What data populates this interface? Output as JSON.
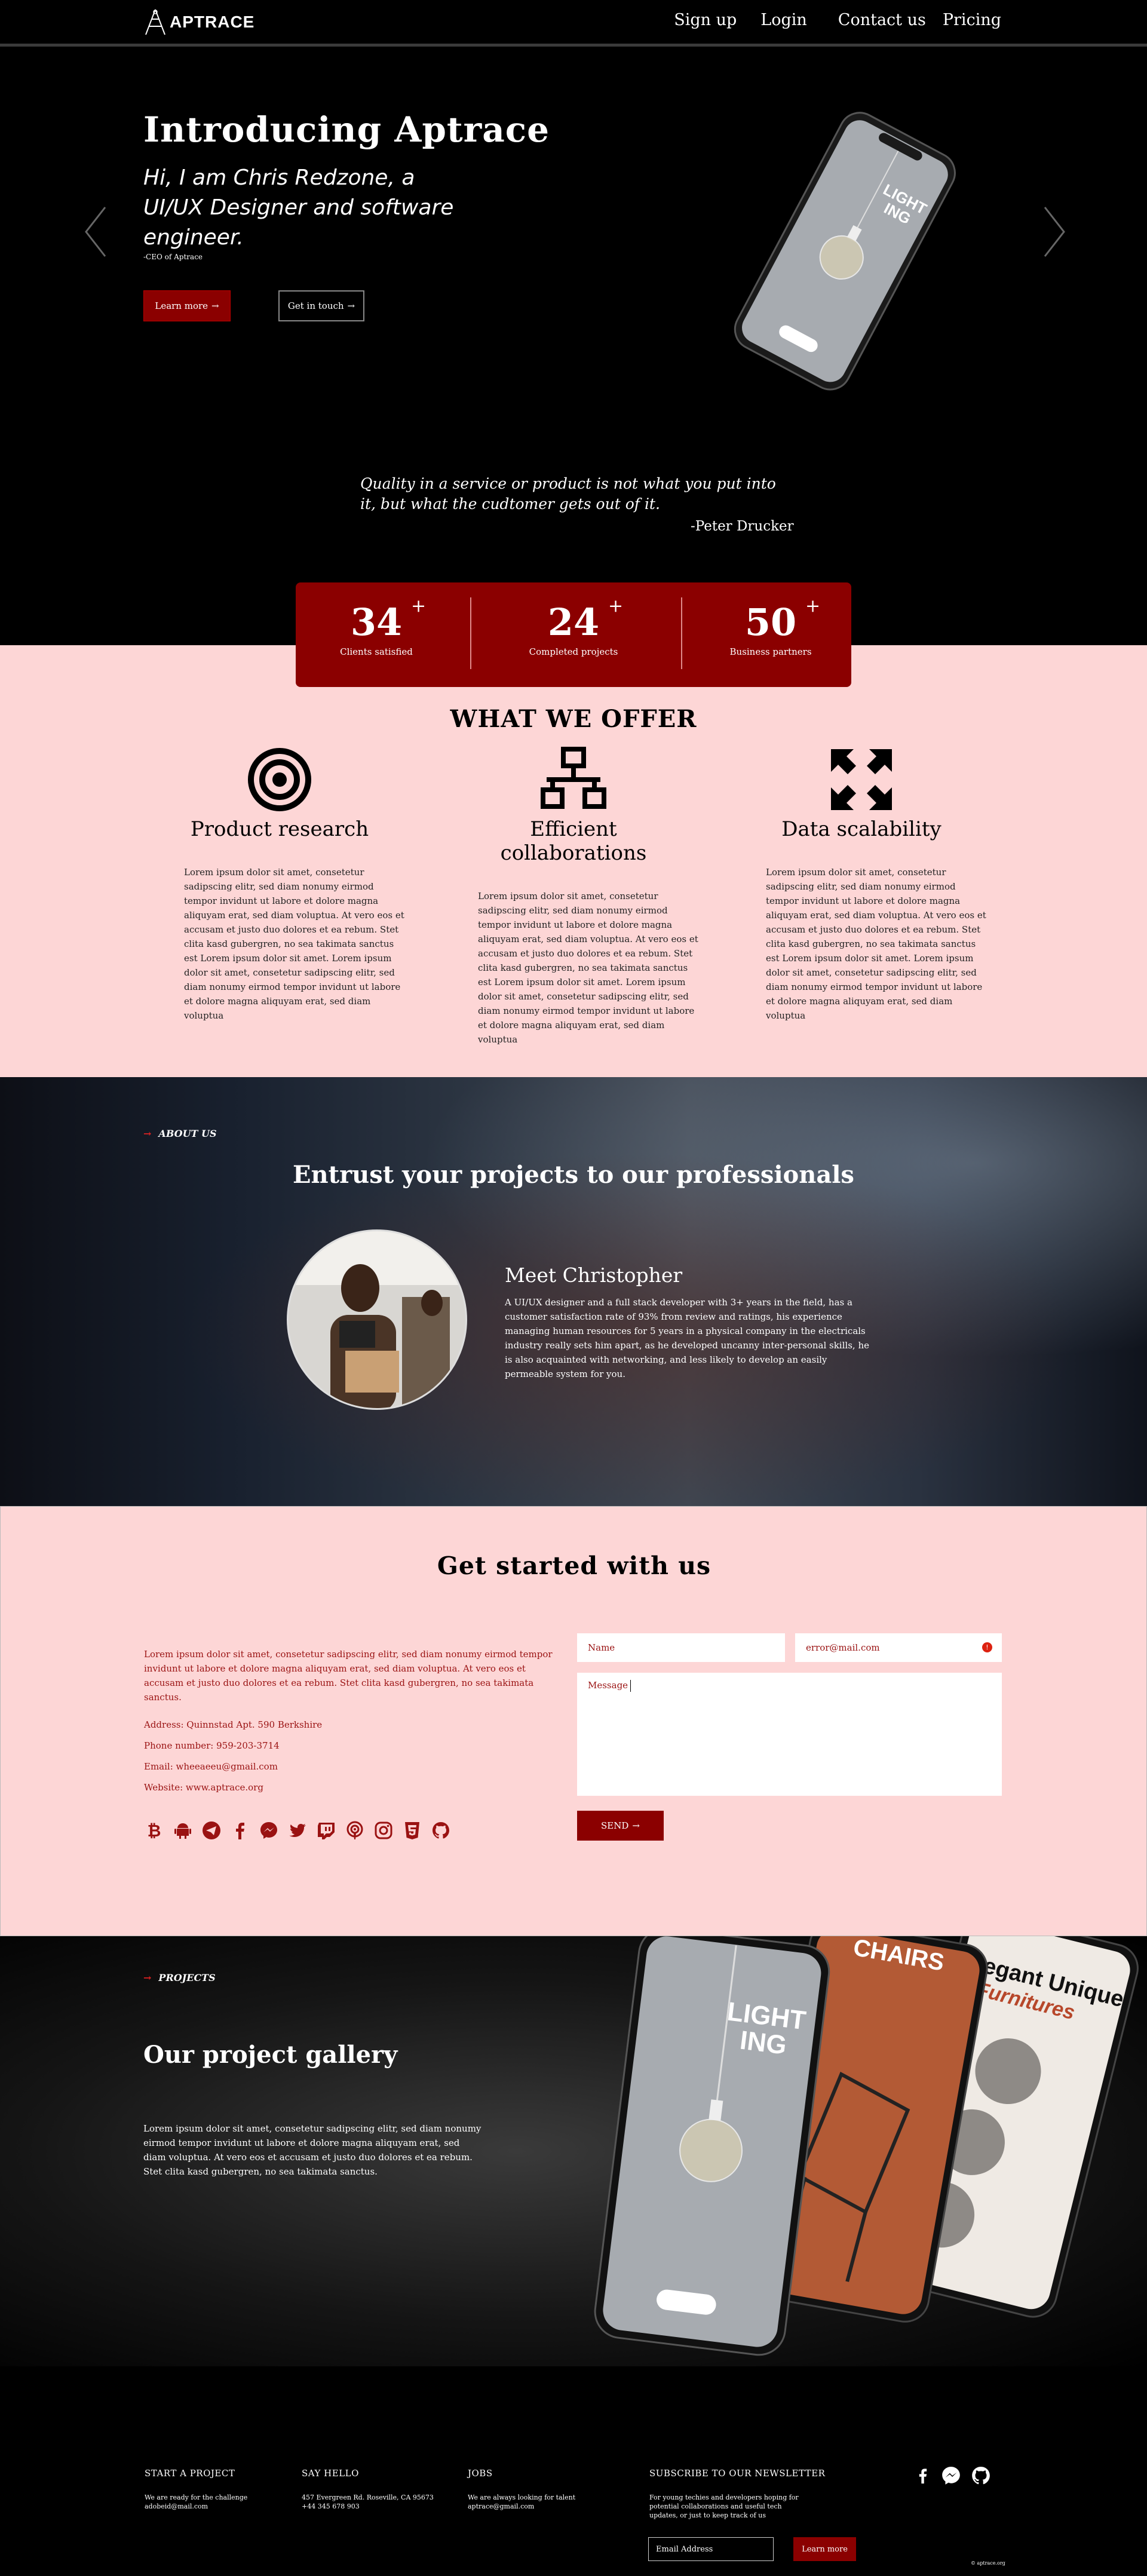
{
  "nav": {
    "brand": "APTRACE",
    "links": [
      "Sign up",
      "Login",
      "Contact us",
      "Pricing"
    ]
  },
  "hero": {
    "title": "Introducing Aptrace",
    "subtitle": "Hi, I am Chris Redzone, a UI/UX Designer and software engineer.",
    "role": "-CEO of Aptrace",
    "learn_more": "Learn more",
    "get_in_touch": "Get in touch",
    "phone_screen": "LIGHT ING",
    "quote": "Quality in a service or product is not what you put into it, but what the cudtomer gets out of it.",
    "quote_author": "-Peter Drucker"
  },
  "stats": [
    {
      "value": "34",
      "suffix": "+",
      "label": "Clients satisfied"
    },
    {
      "value": "24",
      "suffix": "+",
      "label": "Completed projects"
    },
    {
      "value": "50",
      "suffix": "+",
      "label": "Business partners"
    }
  ],
  "offer": {
    "title": "WHAT WE OFFER",
    "items": [
      {
        "icon": "target-icon",
        "title": "Product research",
        "text": "Lorem ipsum dolor sit amet, consetetur sadipscing elitr, sed diam nonumy eirmod tempor invidunt ut labore et dolore magna aliquyam erat, sed diam voluptua. At vero eos et accusam et justo duo dolores et ea rebum. Stet clita kasd gubergren, no sea takimata sanctus est Lorem ipsum dolor sit amet. Lorem ipsum dolor sit amet, consetetur sadipscing elitr, sed diam nonumy eirmod tempor invidunt ut labore et dolore magna aliquyam erat, sed diam voluptua"
      },
      {
        "icon": "network-icon",
        "title": "Efficient collaborations",
        "text": "Lorem ipsum dolor sit amet, consetetur sadipscing elitr, sed diam nonumy eirmod tempor invidunt ut labore et dolore magna aliquyam erat, sed diam voluptua. At vero eos et accusam et justo duo dolores et ea rebum. Stet clita kasd gubergren, no sea takimata sanctus est Lorem ipsum dolor sit amet. Lorem ipsum dolor sit amet, consetetur sadipscing elitr, sed diam nonumy eirmod tempor invidunt ut labore et dolore magna aliquyam erat, sed diam voluptua"
      },
      {
        "icon": "expand-icon",
        "title": "Data scalability",
        "text": "Lorem ipsum dolor sit amet, consetetur sadipscing elitr, sed diam nonumy eirmod tempor invidunt ut labore et dolore magna aliquyam erat, sed diam voluptua. At vero eos et accusam et justo duo dolores et ea rebum. Stet clita kasd gubergren, no sea takimata sanctus est Lorem ipsum dolor sit amet. Lorem ipsum dolor sit amet, consetetur sadipscing elitr, sed diam nonumy eirmod tempor invidunt ut labore et dolore magna aliquyam erat, sed diam voluptua"
      }
    ]
  },
  "about": {
    "label": "ABOUT US",
    "title": "Entrust your projects to our professionals",
    "name": "Meet Christopher",
    "bio": "A UI/UX designer and a full stack developer with 3+ years in the field, has a customer satisfaction rate of 93% from review and ratings, his experience managing human resources for 5 years in a physical company in the electricals industry really sets him apart, as he developed uncanny inter-personal skills, he is also acquainted with networking, and less likely to develop an easily permeable system for you."
  },
  "get_started": {
    "title": "Get started with us",
    "intro": "Lorem ipsum dolor sit amet, consetetur sadipscing elitr, sed diam nonumy eirmod tempor invidunt ut labore et dolore magna aliquyam erat, sed diam voluptua. At vero eos et accusam et justo duo dolores et ea rebum. Stet clita kasd gubergren, no sea takimata sanctus.",
    "address": "Address: Quinnstad Apt. 590 Berkshire",
    "phone": "Phone number: 959-203-3714",
    "email": "Email: wheeaeeu@gmail.com",
    "website": "Website: www.aptrace.org",
    "name_placeholder": "Name",
    "email_placeholder": "error@mail.com",
    "message_placeholder": "Message",
    "send": "SEND"
  },
  "projects": {
    "label": "PROJECTS",
    "title": "Our project gallery",
    "text": "Lorem ipsum dolor sit amet, consetetur sadipscing elitr, sed diam nonumy eirmod tempor invidunt ut labore et dolore magna aliquyam erat, sed diam voluptua. At vero eos et accusam et justo duo dolores et ea rebum. Stet clita kasd gubergren, no sea takimata sanctus.",
    "screen1": "LIGHT ING",
    "screen2": "CHAIRS",
    "screen3": "Elegant Unique Furnitures"
  },
  "footer": {
    "start_title": "START A PROJECT",
    "start_l1": "We are ready for the challenge",
    "start_l2": "adobeid@mail.com",
    "hello_title": "SAY HELLO",
    "hello_l1": "457 Evergreen Rd. Roseville, CA 95673",
    "hello_l2": "+44 345 678 903",
    "jobs_title": "JOBS",
    "jobs_l1": "We are always looking for talent",
    "jobs_l2": "aptrace@gmail.com",
    "news_title": "SUBSCRIBE TO OUR NEWSLETTER",
    "news_text": "For young techies and developers hoping for potential collaborations and useful tech updates, or just to keep track of us",
    "email_placeholder": "Email Address",
    "learn_more": "Learn more",
    "copyright": "© aptrace.org"
  },
  "colors": {
    "accent": "#8b0000",
    "pink": "#fdd6d6",
    "dark": "#000000"
  }
}
